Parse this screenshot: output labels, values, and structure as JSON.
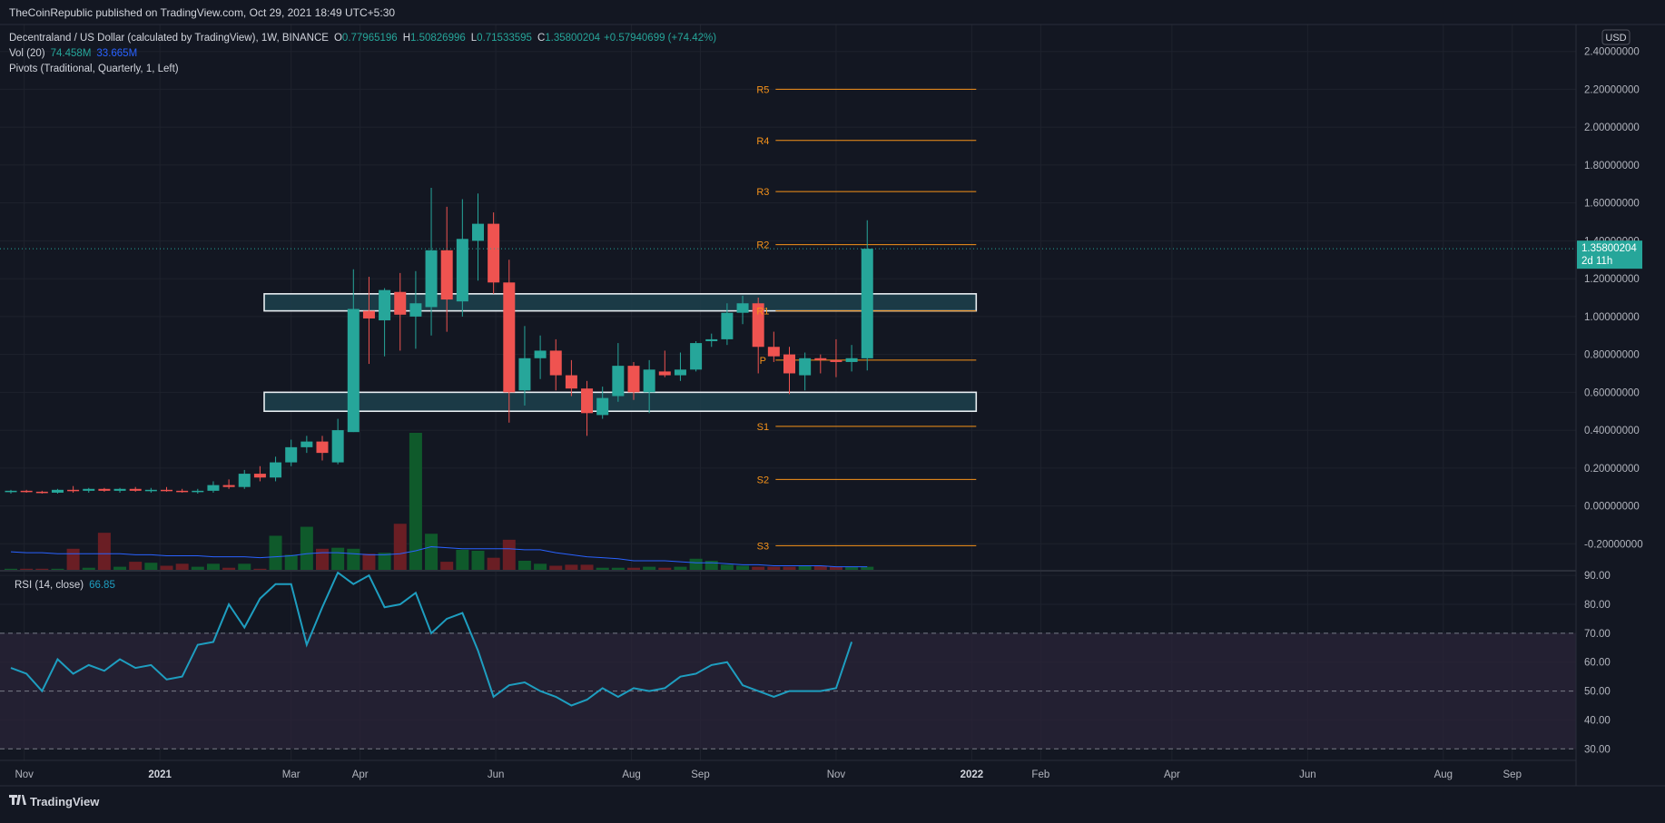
{
  "header": {
    "publisher": "TheCoinRepublic published on TradingView.com, Oct 29, 2021 18:49 UTC+5:30"
  },
  "legend": {
    "title": "Decentraland / US Dollar (calculated by TradingView), 1W, BINANCE",
    "o_label": "O",
    "o": "0.77965196",
    "h_label": "H",
    "h": "1.50826996",
    "l_label": "L",
    "l": "0.71533595",
    "c_label": "C",
    "c": "1.35800204",
    "change": "+0.57940699 (+74.42%)",
    "vol_label": "Vol (20)",
    "vol_value": "74.458M",
    "vol_ma": "33.665M",
    "pivots_label": "Pivots (Traditional, Quarterly, 1, Left)",
    "rsi_label": "RSI (14, close)",
    "rsi_value": "66.85"
  },
  "price_axis": {
    "currency": "USD",
    "last_price": "1.35800204",
    "countdown": "2d 11h",
    "ticks": [
      "2.40000000",
      "2.20000000",
      "2.00000000",
      "1.80000000",
      "1.60000000",
      "1.40000000",
      "1.20000000",
      "1.00000000",
      "0.80000000",
      "0.60000000",
      "0.40000000",
      "0.20000000",
      "0.00000000",
      "-0.20000000"
    ]
  },
  "rsi_axis": {
    "ticks": [
      "90.00",
      "80.00",
      "70.00",
      "60.00",
      "50.00",
      "40.00",
      "30.00"
    ]
  },
  "time_axis": {
    "labels": [
      "Nov",
      "2021",
      "Mar",
      "Apr",
      "Jun",
      "Aug",
      "Sep",
      "Nov",
      "2022",
      "Feb",
      "Apr",
      "Jun",
      "Aug",
      "Sep"
    ]
  },
  "footer": {
    "brand": "TradingView"
  },
  "colors": {
    "background": "#131722",
    "grid": "#1e222d",
    "text": "#b2b5be",
    "up": "#26a69a",
    "down": "#ef5350",
    "vol_up": "#0f5a2b",
    "vol_down": "#6a1e24",
    "vol_ma": "#2962ff",
    "pivot": "#f7931a",
    "rsi_line": "#1e9ec0",
    "rsi_band": "#2a2438",
    "zone_fill": "#1d3e4a",
    "zone_border": "#e8eef2"
  },
  "chart_data": [
    {
      "type": "candlestick",
      "title": "Decentraland / US Dollar (calculated by TradingView), 1W, BINANCE",
      "ylim": [
        -0.28,
        2.48
      ],
      "grid": true,
      "candles": [
        {
          "x": "2020-10-26",
          "o": 0.075,
          "h": 0.085,
          "l": 0.065,
          "c": 0.08
        },
        {
          "x": "2020-11-02",
          "o": 0.08,
          "h": 0.085,
          "l": 0.07,
          "c": 0.075
        },
        {
          "x": "2020-11-09",
          "o": 0.075,
          "h": 0.08,
          "l": 0.065,
          "c": 0.07
        },
        {
          "x": "2020-11-16",
          "o": 0.07,
          "h": 0.09,
          "l": 0.065,
          "c": 0.085
        },
        {
          "x": "2020-11-23",
          "o": 0.085,
          "h": 0.105,
          "l": 0.07,
          "c": 0.08
        },
        {
          "x": "2020-11-30",
          "o": 0.08,
          "h": 0.095,
          "l": 0.07,
          "c": 0.09
        },
        {
          "x": "2020-12-07",
          "o": 0.09,
          "h": 0.095,
          "l": 0.075,
          "c": 0.08
        },
        {
          "x": "2020-12-14",
          "o": 0.08,
          "h": 0.095,
          "l": 0.07,
          "c": 0.09
        },
        {
          "x": "2020-12-21",
          "o": 0.09,
          "h": 0.1,
          "l": 0.075,
          "c": 0.08
        },
        {
          "x": "2020-12-28",
          "o": 0.08,
          "h": 0.095,
          "l": 0.07,
          "c": 0.085
        },
        {
          "x": "2021-01-04",
          "o": 0.085,
          "h": 0.1,
          "l": 0.075,
          "c": 0.08
        },
        {
          "x": "2021-01-11",
          "o": 0.08,
          "h": 0.09,
          "l": 0.07,
          "c": 0.075
        },
        {
          "x": "2021-01-18",
          "o": 0.075,
          "h": 0.09,
          "l": 0.065,
          "c": 0.08
        },
        {
          "x": "2021-01-25",
          "o": 0.08,
          "h": 0.13,
          "l": 0.07,
          "c": 0.11
        },
        {
          "x": "2021-02-01",
          "o": 0.11,
          "h": 0.14,
          "l": 0.09,
          "c": 0.1
        },
        {
          "x": "2021-02-08",
          "o": 0.1,
          "h": 0.19,
          "l": 0.09,
          "c": 0.17
        },
        {
          "x": "2021-02-15",
          "o": 0.17,
          "h": 0.21,
          "l": 0.13,
          "c": 0.15
        },
        {
          "x": "2021-02-22",
          "o": 0.15,
          "h": 0.26,
          "l": 0.13,
          "c": 0.23
        },
        {
          "x": "2021-03-01",
          "o": 0.23,
          "h": 0.35,
          "l": 0.21,
          "c": 0.31
        },
        {
          "x": "2021-03-08",
          "o": 0.31,
          "h": 0.37,
          "l": 0.28,
          "c": 0.34
        },
        {
          "x": "2021-03-15",
          "o": 0.34,
          "h": 0.37,
          "l": 0.24,
          "c": 0.28
        },
        {
          "x": "2021-03-22",
          "o": 0.23,
          "h": 0.46,
          "l": 0.22,
          "c": 0.4
        },
        {
          "x": "2021-03-29",
          "o": 0.39,
          "h": 1.25,
          "l": 0.39,
          "c": 1.04
        },
        {
          "x": "2021-04-05",
          "o": 1.03,
          "h": 1.21,
          "l": 0.75,
          "c": 0.99
        },
        {
          "x": "2021-04-12",
          "o": 0.98,
          "h": 1.15,
          "l": 0.79,
          "c": 1.14
        },
        {
          "x": "2021-04-19",
          "o": 1.13,
          "h": 1.23,
          "l": 0.82,
          "c": 1.01
        },
        {
          "x": "2021-04-26",
          "o": 1.0,
          "h": 1.24,
          "l": 0.83,
          "c": 1.07
        },
        {
          "x": "2021-05-03",
          "o": 1.05,
          "h": 1.68,
          "l": 0.9,
          "c": 1.35
        },
        {
          "x": "2021-05-10",
          "o": 1.35,
          "h": 1.58,
          "l": 0.92,
          "c": 1.09
        },
        {
          "x": "2021-05-17",
          "o": 1.08,
          "h": 1.62,
          "l": 1.0,
          "c": 1.41
        },
        {
          "x": "2021-05-24",
          "o": 1.4,
          "h": 1.65,
          "l": 1.19,
          "c": 1.49
        },
        {
          "x": "2021-05-31",
          "o": 1.49,
          "h": 1.55,
          "l": 1.12,
          "c": 1.18
        },
        {
          "x": "2021-06-07",
          "o": 1.18,
          "h": 1.3,
          "l": 0.44,
          "c": 0.6
        },
        {
          "x": "2021-06-14",
          "o": 0.61,
          "h": 0.95,
          "l": 0.53,
          "c": 0.78
        },
        {
          "x": "2021-06-21",
          "o": 0.78,
          "h": 0.9,
          "l": 0.67,
          "c": 0.82
        },
        {
          "x": "2021-06-28",
          "o": 0.82,
          "h": 0.88,
          "l": 0.61,
          "c": 0.69
        },
        {
          "x": "2021-07-05",
          "o": 0.69,
          "h": 0.77,
          "l": 0.58,
          "c": 0.62
        },
        {
          "x": "2021-07-12",
          "o": 0.62,
          "h": 0.66,
          "l": 0.37,
          "c": 0.49
        },
        {
          "x": "2021-07-19",
          "o": 0.48,
          "h": 0.63,
          "l": 0.46,
          "c": 0.57
        },
        {
          "x": "2021-07-26",
          "o": 0.58,
          "h": 0.86,
          "l": 0.55,
          "c": 0.74
        },
        {
          "x": "2021-08-02",
          "o": 0.74,
          "h": 0.76,
          "l": 0.56,
          "c": 0.6
        },
        {
          "x": "2021-08-09",
          "o": 0.6,
          "h": 0.77,
          "l": 0.49,
          "c": 0.72
        },
        {
          "x": "2021-08-16",
          "o": 0.71,
          "h": 0.82,
          "l": 0.68,
          "c": 0.69
        },
        {
          "x": "2021-08-23",
          "o": 0.69,
          "h": 0.81,
          "l": 0.66,
          "c": 0.72
        },
        {
          "x": "2021-08-30",
          "o": 0.72,
          "h": 0.87,
          "l": 0.71,
          "c": 0.86
        },
        {
          "x": "2021-09-06",
          "o": 0.87,
          "h": 0.91,
          "l": 0.84,
          "c": 0.88
        },
        {
          "x": "2021-09-13",
          "o": 0.88,
          "h": 1.07,
          "l": 0.85,
          "c": 1.02
        },
        {
          "x": "2021-09-20",
          "o": 1.02,
          "h": 1.11,
          "l": 0.96,
          "c": 1.07
        },
        {
          "x": "2021-09-27",
          "o": 1.07,
          "h": 1.1,
          "l": 0.7,
          "c": 0.84
        },
        {
          "x": "2021-10-04",
          "o": 0.84,
          "h": 0.92,
          "l": 0.76,
          "c": 0.79
        },
        {
          "x": "2021-10-11",
          "o": 0.8,
          "h": 0.84,
          "l": 0.59,
          "c": 0.7
        },
        {
          "x": "2021-10-18",
          "o": 0.69,
          "h": 0.81,
          "l": 0.61,
          "c": 0.78
        },
        {
          "x": "2021-10-25",
          "o": 0.78,
          "h": 0.8,
          "l": 0.7,
          "c": 0.77
        },
        {
          "x": "2021-11-01",
          "o": 0.77,
          "h": 0.88,
          "l": 0.68,
          "c": 0.76
        },
        {
          "x": "2021-11-08",
          "o": 0.76,
          "h": 0.85,
          "l": 0.71,
          "c": 0.78
        },
        {
          "x": "2021-11-15",
          "o": 0.77965196,
          "h": 1.50826996,
          "l": 0.71533595,
          "c": 1.35800204
        }
      ],
      "pivots": [
        {
          "label": "R5",
          "value": 2.2
        },
        {
          "label": "R4",
          "value": 1.93
        },
        {
          "label": "R3",
          "value": 1.66
        },
        {
          "label": "R2",
          "value": 1.38
        },
        {
          "label": "R1",
          "value": 1.03
        },
        {
          "label": "P",
          "value": 0.77
        },
        {
          "label": "S1",
          "value": 0.42
        },
        {
          "label": "S2",
          "value": 0.14
        },
        {
          "label": "S3",
          "value": -0.21
        }
      ],
      "zones": [
        {
          "from": "2020-10-26",
          "to": "2022-01-03",
          "top": 1.12,
          "bottom": 1.03
        },
        {
          "from": "2020-10-26",
          "to": "2022-01-03",
          "top": 0.6,
          "bottom": 0.5
        }
      ]
    },
    {
      "type": "bar",
      "title": "Vol (20)",
      "values": [
        2,
        2,
        2,
        2,
        22,
        3,
        38,
        4,
        9,
        8,
        5,
        7,
        4,
        7,
        3,
        7,
        2,
        35,
        16,
        44,
        22,
        23,
        22,
        17,
        18,
        47,
        138,
        37,
        9,
        21,
        20,
        13,
        31,
        10,
        7,
        5,
        6,
        6,
        3,
        3,
        3,
        4,
        3,
        4,
        12,
        10,
        6,
        5,
        4,
        4,
        4,
        5,
        5,
        4,
        4,
        4,
        3,
        4,
        3,
        4,
        7
      ],
      "ma": [
        19,
        18,
        18,
        17,
        17,
        17,
        17,
        17,
        16,
        16,
        15,
        15,
        15,
        14,
        14,
        14,
        13,
        14,
        15,
        17,
        18,
        18,
        17,
        16,
        16,
        17,
        20,
        24,
        23,
        22,
        22,
        22,
        22,
        21,
        21,
        18,
        16,
        14,
        13,
        12,
        10,
        10,
        10,
        9,
        8,
        8,
        7,
        6,
        6,
        5,
        5,
        5,
        5,
        4,
        4,
        4,
        4,
        4,
        4,
        4,
        4
      ]
    },
    {
      "type": "line",
      "title": "RSI (14, close)",
      "ylim": [
        26,
        91
      ],
      "bands": {
        "upper": 70,
        "middle": 50,
        "lower": 30
      },
      "values": [
        58,
        56,
        50,
        61,
        56,
        59,
        57,
        61,
        58,
        59,
        54,
        55,
        66,
        67,
        80,
        72,
        82,
        87,
        87,
        66,
        79,
        91,
        87,
        90,
        79,
        80,
        84,
        70,
        75,
        77,
        64,
        48,
        52,
        53,
        50,
        48,
        45,
        47,
        51,
        48,
        51,
        50,
        51,
        55,
        56,
        59,
        60,
        52,
        50,
        48,
        50,
        50,
        50,
        51,
        67
      ]
    }
  ]
}
